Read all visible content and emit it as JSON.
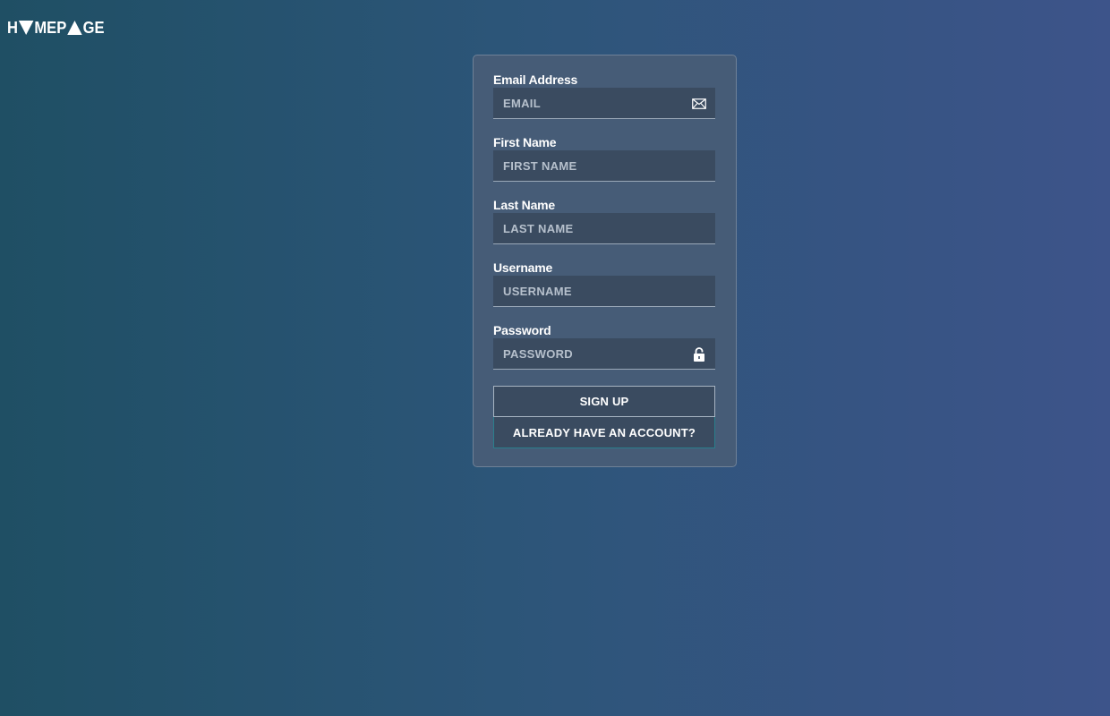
{
  "logo": {
    "text_parts": [
      "H",
      "MEP",
      "GE"
    ],
    "icons": [
      "triangle-down-icon",
      "triangle-up-icon"
    ]
  },
  "form": {
    "fields": [
      {
        "label": "Email Address",
        "placeholder": "EMAIL",
        "type": "email",
        "icon": "envelope-icon"
      },
      {
        "label": "First Name",
        "placeholder": "FIRST NAME",
        "type": "text"
      },
      {
        "label": "Last Name",
        "placeholder": "LAST NAME",
        "type": "text"
      },
      {
        "label": "Username",
        "placeholder": "USERNAME",
        "type": "text"
      },
      {
        "label": "Password",
        "placeholder": "PASSWORD",
        "type": "password",
        "icon": "lock-icon"
      }
    ],
    "signup_label": "SIGN UP",
    "login_label": "ALREADY HAVE AN ACCOUNT?"
  },
  "colors": {
    "background_start": "#1f4f64",
    "background_end": "#3d548a",
    "card": "#465c77",
    "input": "#3a4b60"
  }
}
